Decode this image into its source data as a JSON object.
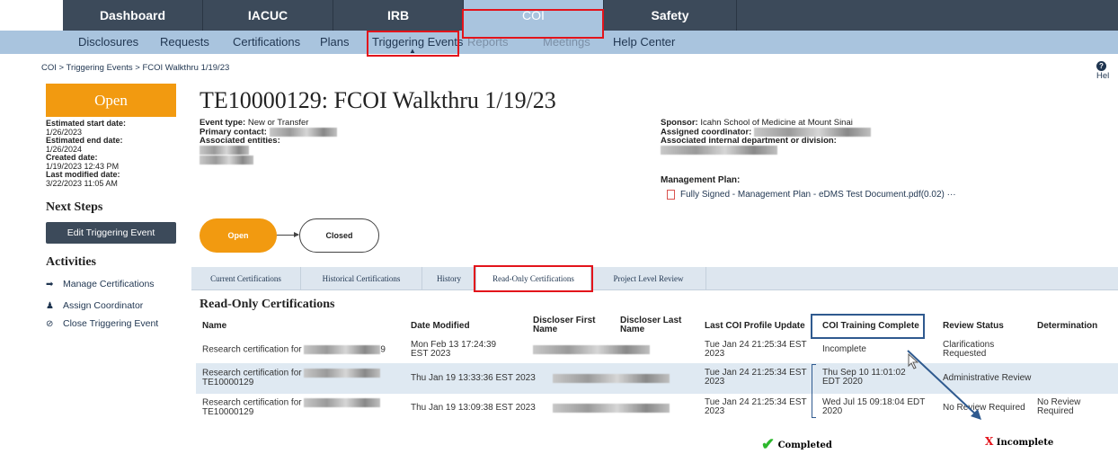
{
  "top_nav": [
    "Dashboard",
    "IACUC",
    "IRB",
    "COI",
    "Safety"
  ],
  "sub_nav": [
    "Disclosures",
    "Requests",
    "Certifications",
    "Plans",
    "Triggering Events",
    "Reports",
    "Meetings",
    "Help Center"
  ],
  "breadcrumb": "COI > Triggering Events > FCOI Walkthru 1/19/23",
  "help": "Help",
  "status": "Open",
  "meta": {
    "start_label": "Estimated start date:",
    "start": "1/26/2023",
    "end_label": "Estimated end date:",
    "end": "1/26/2024",
    "created_label": "Created date:",
    "created": "1/19/2023 12:43 PM",
    "modified_label": "Last modified date:",
    "modified": "3/22/2023 11:05 AM"
  },
  "next_steps": {
    "heading": "Next Steps",
    "edit_button": "Edit Triggering Event"
  },
  "activities": {
    "heading": "Activities",
    "items": [
      "Manage Certifications",
      "Assign Coordinator",
      "Close Triggering Event"
    ]
  },
  "title": "TE10000129: FCOI Walkthru 1/19/23",
  "event": {
    "type_label": "Event type:",
    "type": "New or Transfer",
    "contact_label": "Primary contact:",
    "entities_label": "Associated entities:"
  },
  "sponsor": {
    "sponsor_label": "Sponsor:",
    "sponsor": "Icahn School of Medicine at Mount Sinai",
    "coordinator_label": "Assigned coordinator:",
    "dept_label": "Associated internal department or division:"
  },
  "management_plan": {
    "label": "Management Plan:",
    "file": "Fully Signed - Management Plan - eDMS Test Document.pdf(0.02)",
    "more": "···"
  },
  "workflow": {
    "open": "Open",
    "closed": "Closed"
  },
  "tabs": [
    "Current Certifications",
    "Historical Certifications",
    "History",
    "Read-Only Certifications",
    "Project Level Review"
  ],
  "section_title": "Read-Only Certifications",
  "columns": [
    "Name",
    "Date Modified",
    "Discloser First Name",
    "Discloser Last Name",
    "Last COI Profile Update",
    "COI Training Complete",
    "Review Status",
    "Determination"
  ],
  "rows": [
    {
      "name": "Research certification for",
      "name2": "",
      "suffix": "9",
      "date": "Mon Feb 13 17:24:39 EST 2023",
      "profile": "Tue Jan 24 21:25:34 EST 2023",
      "training": "Incomplete",
      "review": "Clarifications Requested",
      "determination": ""
    },
    {
      "name": "Research certification for",
      "name2": "TE10000129",
      "suffix": "",
      "date": "Thu Jan 19 13:33:36 EST 2023",
      "profile": "Tue Jan 24 21:25:34 EST 2023",
      "training": "Thu Sep 10 11:01:02 EDT 2020",
      "review": "Administrative Review",
      "determination": ""
    },
    {
      "name": "Research certification for",
      "name2": "TE10000129",
      "suffix": "",
      "date": "Thu Jan 19 13:09:38 EST 2023",
      "profile": "Tue Jan 24 21:25:34 EST 2023",
      "training": "Wed Jul 15 09:18:04 EDT 2020",
      "review": "No Review Required",
      "determination": "No Review Required"
    }
  ],
  "legend": {
    "completed": "Completed",
    "incomplete": "Incomplete"
  },
  "colors": {
    "nav": "#3c4a5a",
    "subnav": "#a9c4de",
    "accent": "#f29a10",
    "annotation_red": "#e3141b",
    "annotation_blue": "#2f5a8f",
    "check_green": "#2db82d"
  }
}
